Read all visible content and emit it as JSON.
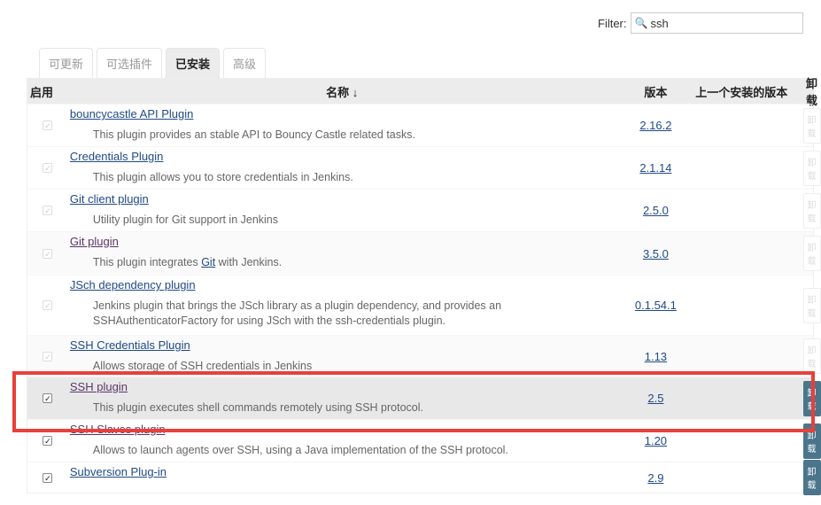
{
  "filter": {
    "label": "Filter:",
    "value": "ssh",
    "icon": "search-icon"
  },
  "tabs": [
    {
      "label": "可更新"
    },
    {
      "label": "可选插件"
    },
    {
      "label": "已安装"
    },
    {
      "label": "高级"
    }
  ],
  "columns": {
    "enabled": "启用",
    "name": "名称 ↓",
    "version": "版本",
    "previous": "上一个安装的版本",
    "uninstall": "卸载"
  },
  "plugins": [
    {
      "name": "bouncycastle API Plugin",
      "desc": "This plugin provides an stable API to Bouncy Castle related tasks.",
      "version": "2.16.2",
      "enabled": true,
      "can_uninstall": false
    },
    {
      "name": "Credentials Plugin",
      "desc": "This plugin allows you to store credentials in Jenkins.",
      "version": "2.1.14",
      "enabled": true,
      "can_uninstall": false
    },
    {
      "name": "Git client plugin",
      "desc": "Utility plugin for Git support in Jenkins",
      "version": "2.5.0",
      "enabled": true,
      "can_uninstall": false
    },
    {
      "name": "Git plugin",
      "desc_pre": "This plugin integrates ",
      "desc_link": "Git",
      "desc_post": " with Jenkins.",
      "version": "3.5.0",
      "enabled": true,
      "can_uninstall": false
    },
    {
      "name": "JSch dependency plugin",
      "desc": "Jenkins plugin that brings the JSch library as a plugin dependency, and provides an SSHAuthenticatorFactory for using JSch with the ssh-credentials plugin.",
      "version": "0.1.54.1",
      "enabled": true,
      "can_uninstall": false
    },
    {
      "name": "SSH Credentials Plugin",
      "desc": "Allows storage of SSH credentials in Jenkins",
      "version": "1.13",
      "enabled": true,
      "can_uninstall": false
    },
    {
      "name": "SSH plugin",
      "desc": "This plugin executes shell commands remotely using SSH protocol.",
      "version": "2.5",
      "enabled": true,
      "can_uninstall": true
    },
    {
      "name": "SSH Slaves plugin",
      "desc": "Allows to launch agents over SSH, using a Java implementation of the SSH protocol.",
      "version": "1.20",
      "enabled": true,
      "can_uninstall": true
    },
    {
      "name": "Subversion Plug-in",
      "desc": "",
      "version": "2.9",
      "enabled": true,
      "can_uninstall": true
    }
  ],
  "uninstall_label": "卸载",
  "colors": {
    "accent": "#4b758b",
    "highlight": "#e8403a"
  }
}
